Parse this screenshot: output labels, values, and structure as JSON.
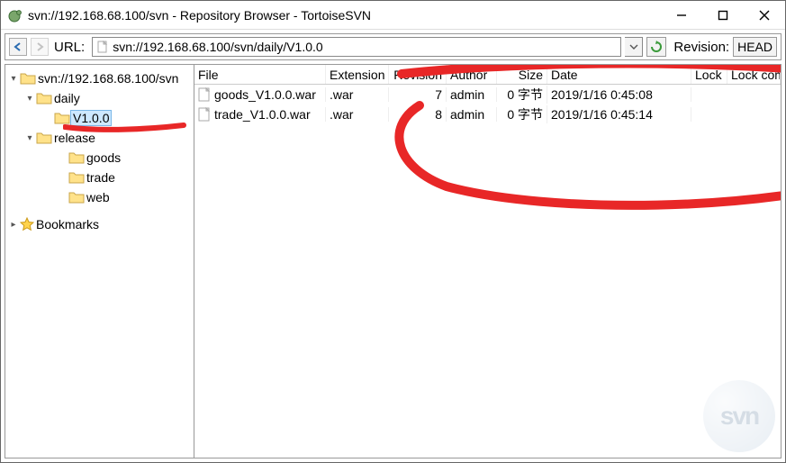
{
  "titlebar": {
    "title": "svn://192.168.68.100/svn - Repository Browser - TortoiseSVN"
  },
  "urlbar": {
    "label": "URL:",
    "url": "svn://192.168.68.100/svn/daily/V1.0.0",
    "revision_label": "Revision:",
    "head": "HEAD"
  },
  "tree": {
    "root_label": "svn://192.168.68.100/svn",
    "nodes": {
      "daily": "daily",
      "v100": "V1.0.0",
      "release": "release",
      "goods": "goods",
      "trade": "trade",
      "web": "web"
    },
    "bookmarks": "Bookmarks"
  },
  "list": {
    "headers": {
      "file": "File",
      "extension": "Extension",
      "revision": "Revision",
      "author": "Author",
      "size": "Size",
      "date": "Date",
      "lock": "Lock",
      "lock_comment": "Lock comme"
    },
    "rows": [
      {
        "file": "goods_V1.0.0.war",
        "ext": ".war",
        "rev": "7",
        "author": "admin",
        "size": "0 字节",
        "date": "2019/1/16 0:45:08",
        "lock": "",
        "lockc": ""
      },
      {
        "file": "trade_V1.0.0.war",
        "ext": ".war",
        "rev": "8",
        "author": "admin",
        "size": "0 字节",
        "date": "2019/1/16 0:45:14",
        "lock": "",
        "lockc": ""
      }
    ]
  }
}
